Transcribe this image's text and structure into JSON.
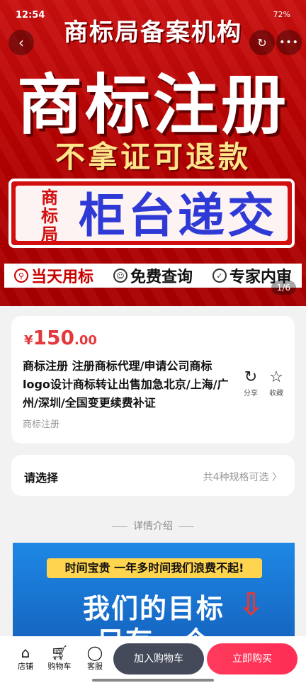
{
  "status": {
    "time": "12:54",
    "battery": "72%"
  },
  "nav": {
    "back_icon": "chevron-left-icon",
    "share_icon": "refresh-icon",
    "more_icon": "more-dots-icon"
  },
  "hero": {
    "top_text": "商标局备案机构",
    "main_text": "商标注册",
    "sub_text": "不拿证可退款",
    "box_side": "商标局",
    "box_text": "柜台递交",
    "strip": [
      "当天用标",
      "免费查询",
      "专家内审"
    ],
    "pager": "1/6"
  },
  "product": {
    "currency": "¥",
    "price_int": "150",
    "price_dec": ".00",
    "title": "商标注册 注册商标代理/申请公司商标logo设计商标转让出售加急北京/上海/广州/深圳/全国变更续费补证",
    "category": "商标注册",
    "share_label": "分享",
    "fav_label": "收藏"
  },
  "spec": {
    "label": "请选择",
    "value": "共4种规格可选 〉"
  },
  "detail": {
    "divider": "详情介绍",
    "banner": "时间宝贵 一年多时间我们浪费不起!",
    "head": "我们的目标",
    "head2": "只有一个"
  },
  "bottom": {
    "shop": "店铺",
    "cart": "购物车",
    "service": "客服",
    "add_cart": "加入购物车",
    "buy_now": "立即购买"
  },
  "colors": {
    "price": "#e4393c",
    "hero_red": "#c9100f",
    "buy": "#ff2d55",
    "cart_btn": "#444a59"
  }
}
